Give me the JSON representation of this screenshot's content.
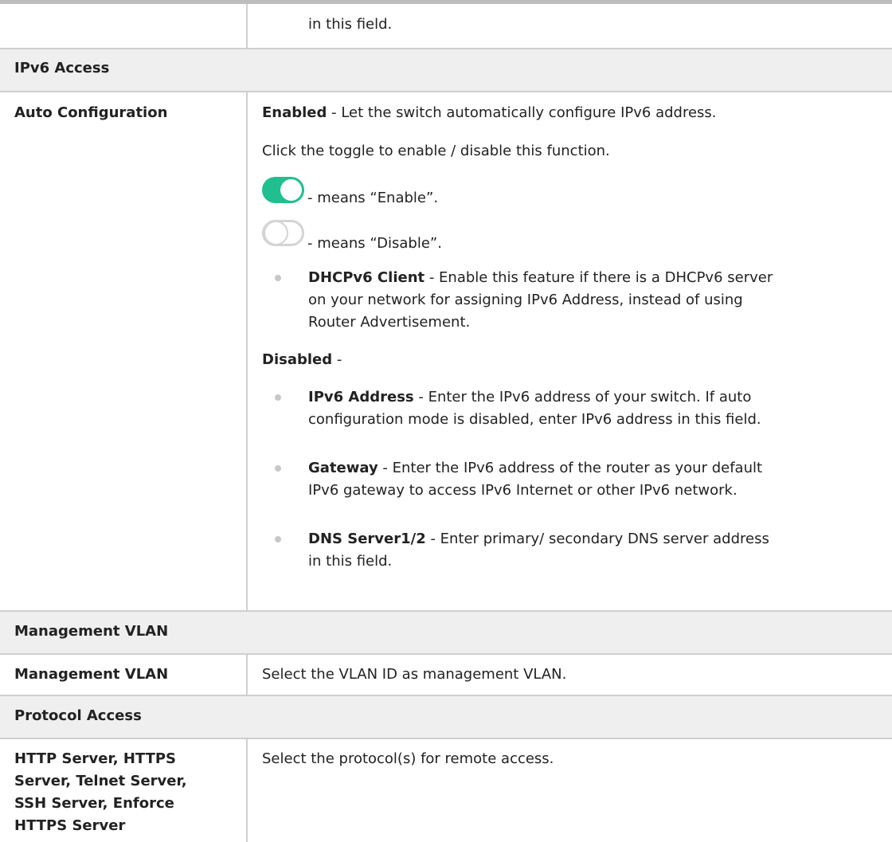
{
  "row_continued": {
    "text": "in this field."
  },
  "ipv6": {
    "section_title": "IPv6 Access",
    "field_label": "Auto Configuration",
    "enabled_label": "Enabled",
    "enabled_desc": " - Let the switch automatically configure IPv6 address.",
    "click_toggle": "Click the toggle to enable / disable this function.",
    "toggle_on_text": "- means “Enable”.",
    "toggle_off_text": "- means “Disable”.",
    "dhcp": {
      "label": "DHCPv6 Client",
      "line1": " - Enable this feature if there is a DHCPv6 server",
      "line2": "on your network for assigning IPv6 Address, instead of using",
      "line3": "Router Advertisement."
    },
    "disabled_label": "Disabled",
    "disabled_suffix": " -",
    "addr": {
      "label": "IPv6 Address",
      "line1": " - Enter the IPv6 address of your switch. If auto",
      "line2": "configuration mode is disabled, enter IPv6 address in this field."
    },
    "gateway": {
      "label": "Gateway",
      "line1": " - Enter the IPv6 address of the router as your default",
      "line2": "IPv6 gateway to access IPv6 Internet or other IPv6 network."
    },
    "dns": {
      "label": "DNS Server1/2",
      "line1": " - Enter primary/ secondary DNS server address",
      "line2": "in this field."
    },
    "toggle_on_color": "#1fbf8f",
    "toggle_off_color": "#d4d4d4"
  },
  "mgmt_vlan": {
    "section_title": "Management VLAN",
    "field_label": "Management VLAN",
    "desc": "Select the VLAN ID as management VLAN."
  },
  "protocol": {
    "section_title": "Protocol Access",
    "field_label_lines": [
      "HTTP Server, HTTPS",
      "Server, Telnet Server,",
      "SSH Server, Enforce",
      "HTTPS Server"
    ],
    "desc": "Select the protocol(s) for remote access."
  }
}
